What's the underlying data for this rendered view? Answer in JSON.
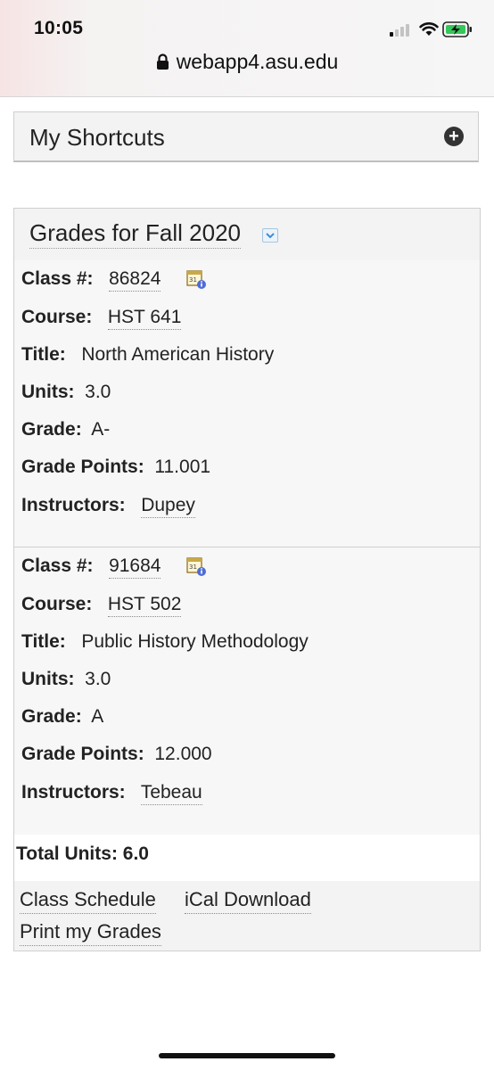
{
  "status_bar": {
    "time": "10:05",
    "url": "webapp4.asu.edu"
  },
  "shortcuts": {
    "title": "My Shortcuts"
  },
  "grades": {
    "title": "Grades for Fall 2020",
    "classes": [
      {
        "class_label": "Class #:",
        "class_number": "86824",
        "course_label": "Course:",
        "course": "HST 641",
        "title_label": "Title:",
        "title": "North American History",
        "units_label": "Units:",
        "units": "3.0",
        "grade_label": "Grade:",
        "grade": "A-",
        "points_label": "Grade Points:",
        "points": "11.001",
        "instructors_label": "Instructors:",
        "instructors": "Dupey"
      },
      {
        "class_label": "Class #:",
        "class_number": "91684",
        "course_label": "Course:",
        "course": "HST 502",
        "title_label": "Title:",
        "title": "Public History Methodology",
        "units_label": "Units:",
        "units": "3.0",
        "grade_label": "Grade:",
        "grade": "A",
        "points_label": "Grade Points:",
        "points": "12.000",
        "instructors_label": "Instructors:",
        "instructors": "Tebeau"
      }
    ],
    "total_units": "Total Units: 6.0",
    "links": {
      "class_schedule": "Class Schedule",
      "ical_download": "iCal Download",
      "print_grades": "Print my Grades"
    }
  },
  "icons": {
    "signal": "cellular-signal-icon",
    "wifi": "wifi-icon",
    "battery": "battery-charging-icon",
    "lock": "lock-icon",
    "add": "plus-circle-icon",
    "dropdown": "chevron-down-icon",
    "calendar_info": "calendar-info-icon"
  },
  "colors": {
    "battery_green": "#34c759",
    "dropdown_blue": "#3b8fd6"
  }
}
